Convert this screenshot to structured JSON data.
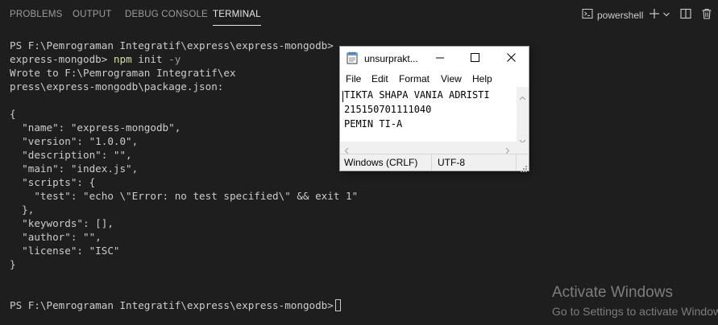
{
  "panel": {
    "tabs": [
      {
        "label": "PROBLEMS"
      },
      {
        "label": "OUTPUT"
      },
      {
        "label": "DEBUG CONSOLE"
      },
      {
        "label": "TERMINAL"
      }
    ],
    "active_tab": "TERMINAL",
    "shell_label": "powershell",
    "icons": [
      "terminal-icon",
      "add-icon",
      "chevron-down-icon",
      "split-icon",
      "trash-icon"
    ]
  },
  "terminal": {
    "prompt1": "PS F:\\Pemrograman Integratif\\express\\express-mongodb>",
    "prompt2_prefix": "express-mongodb> ",
    "cmd": "npm",
    "cmd_arg": " init",
    "cmd_flag": " -y",
    "output": [
      "Wrote to F:\\Pemrograman Integratif\\ex",
      "press\\express-mongodb\\package.json:",
      "",
      "{",
      "  \"name\": \"express-mongodb\",",
      "  \"version\": \"1.0.0\",",
      "  \"description\": \"\",",
      "  \"main\": \"index.js\",",
      "  \"scripts\": {",
      "    \"test\": \"echo \\\"Error: no test specified\\\" && exit 1\"",
      "  },",
      "  \"keywords\": [],",
      "  \"author\": \"\",",
      "  \"license\": \"ISC\"",
      "}",
      "",
      ""
    ],
    "final_prompt": "PS F:\\Pemrograman Integratif\\express\\express-mongodb>"
  },
  "notepad": {
    "title": "unsurprakt...",
    "menu": [
      "File",
      "Edit",
      "Format",
      "View",
      "Help"
    ],
    "lines": [
      "TIKTA SHAPA VANIA ADRISTI",
      "215150701111040",
      "PEMIN TI-A"
    ],
    "status": {
      "line_ending": "Windows (CRLF)",
      "encoding": "UTF-8"
    }
  },
  "watermark": {
    "title": "Activate Windows",
    "subtitle": "Go to Settings to activate Windows."
  },
  "colors": {
    "background": "#1e1e1e",
    "text": "#cccccc",
    "npm_command": "#dcdcaa",
    "watermark": "#7d7d7d"
  }
}
